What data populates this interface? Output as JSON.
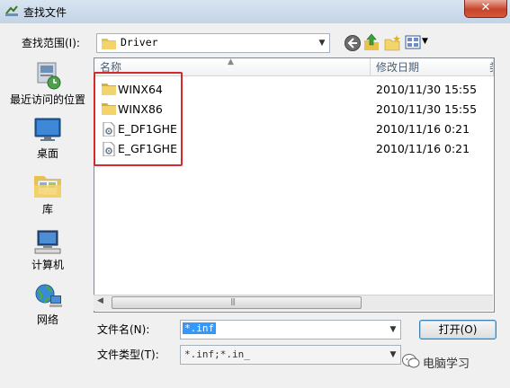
{
  "window": {
    "title": "查找文件",
    "close_glyph": "✕"
  },
  "lookin": {
    "label": "查找范围(I):",
    "value": "Driver"
  },
  "sidebar": {
    "items": [
      {
        "label": "最近访问的位置",
        "icon": "recent-places-icon"
      },
      {
        "label": "桌面",
        "icon": "desktop-icon"
      },
      {
        "label": "库",
        "icon": "library-icon"
      },
      {
        "label": "计算机",
        "icon": "computer-icon"
      },
      {
        "label": "网络",
        "icon": "network-icon"
      }
    ]
  },
  "filelist": {
    "columns": [
      "名称",
      "修改日期",
      "类"
    ],
    "rows": [
      {
        "name": "WINX64",
        "date": "2010/11/30 15:55",
        "type": "folder"
      },
      {
        "name": "WINX86",
        "date": "2010/11/30 15:55",
        "type": "folder"
      },
      {
        "name": "E_DF1GHE",
        "date": "2010/11/16 0:21",
        "type": "file"
      },
      {
        "name": "E_GF1GHE",
        "date": "2010/11/16 0:21",
        "type": "file"
      }
    ]
  },
  "filename": {
    "label": "文件名(N):",
    "value": "*.inf"
  },
  "filetype": {
    "label": "文件类型(T):",
    "value": "*.inf;*.in_"
  },
  "buttons": {
    "open": "打开(O)"
  },
  "watermark": {
    "text": "电脑学习"
  },
  "colors": {
    "highlight_box": "#d7282a",
    "selection": "#3399ff"
  }
}
